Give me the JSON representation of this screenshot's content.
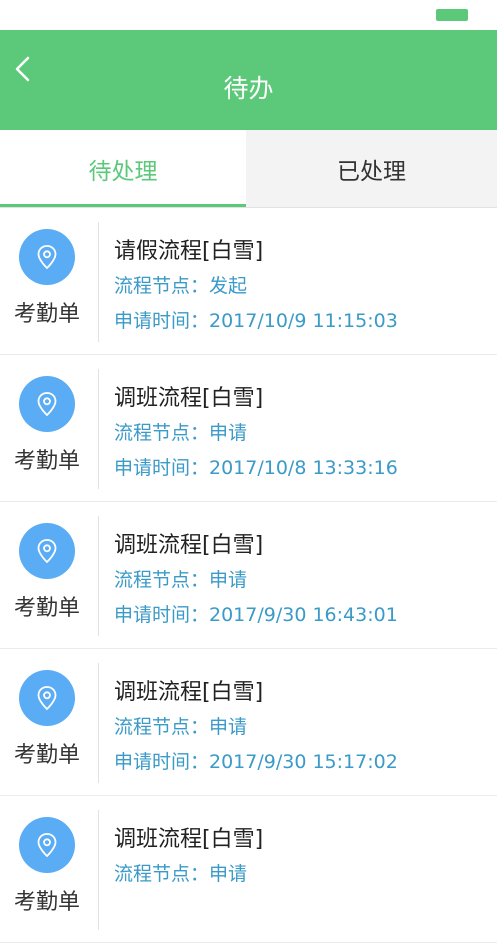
{
  "colors": {
    "accent": "#5cc879",
    "icon_bg": "#5aacf5",
    "meta_text": "#3a9ac8"
  },
  "nav": {
    "title": "待办",
    "back_icon": "chevron-left-icon"
  },
  "tabs": [
    {
      "label": "待处理",
      "active": true
    },
    {
      "label": "已处理",
      "active": false
    }
  ],
  "items": [
    {
      "type": "考勤单",
      "icon": "location-pin-icon",
      "title": "请假流程[白雪]",
      "node": "流程节点：发起",
      "time": "申请时间：2017/10/9 11:15:03"
    },
    {
      "type": "考勤单",
      "icon": "location-pin-icon",
      "title": "调班流程[白雪]",
      "node": "流程节点：申请",
      "time": "申请时间：2017/10/8 13:33:16"
    },
    {
      "type": "考勤单",
      "icon": "location-pin-icon",
      "title": "调班流程[白雪]",
      "node": "流程节点：申请",
      "time": "申请时间：2017/9/30 16:43:01"
    },
    {
      "type": "考勤单",
      "icon": "location-pin-icon",
      "title": "调班流程[白雪]",
      "node": "流程节点：申请",
      "time": "申请时间：2017/9/30 15:17:02"
    },
    {
      "type": "考勤单",
      "icon": "location-pin-icon",
      "title": "调班流程[白雪]",
      "node": "流程节点：申请",
      "time": ""
    }
  ]
}
